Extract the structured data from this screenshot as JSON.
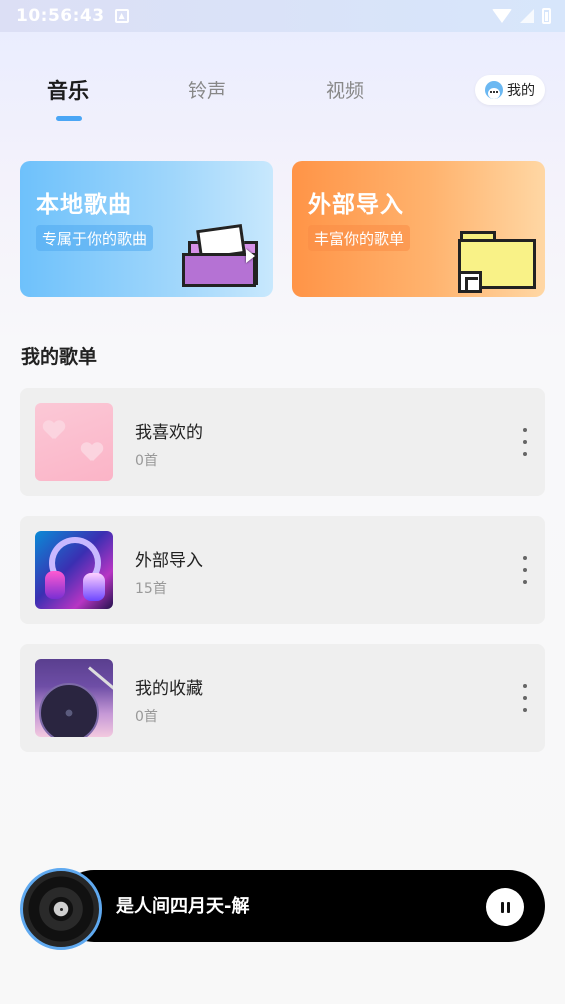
{
  "status_bar": {
    "time": "10:56:43"
  },
  "tabs": [
    {
      "label": "音乐",
      "active": true
    },
    {
      "label": "铃声",
      "active": false
    },
    {
      "label": "视频",
      "active": false
    }
  ],
  "profile": {
    "label": "我的",
    "icon": "avatar-icon"
  },
  "cards": {
    "local": {
      "title": "本地歌曲",
      "subtitle": "专属于你的歌曲",
      "icon": "folder-icon"
    },
    "import": {
      "title": "外部导入",
      "subtitle": "丰富你的歌单",
      "icon": "folder-shortcut-icon"
    }
  },
  "section": {
    "title": "我的歌单"
  },
  "playlists": [
    {
      "title": "我喜欢的",
      "count": "0首",
      "cover": "hearts-cover"
    },
    {
      "title": "外部导入",
      "count": "15首",
      "cover": "headphones-cover"
    },
    {
      "title": "我的收藏",
      "count": "0首",
      "cover": "vinyl-cover"
    }
  ],
  "player": {
    "title": "是人间四月天-解",
    "state": "playing"
  },
  "colors": {
    "accent": "#4aa6f5",
    "local_card": "#6ec1fb",
    "import_card": "#ff9447",
    "player_bg": "#000000"
  }
}
